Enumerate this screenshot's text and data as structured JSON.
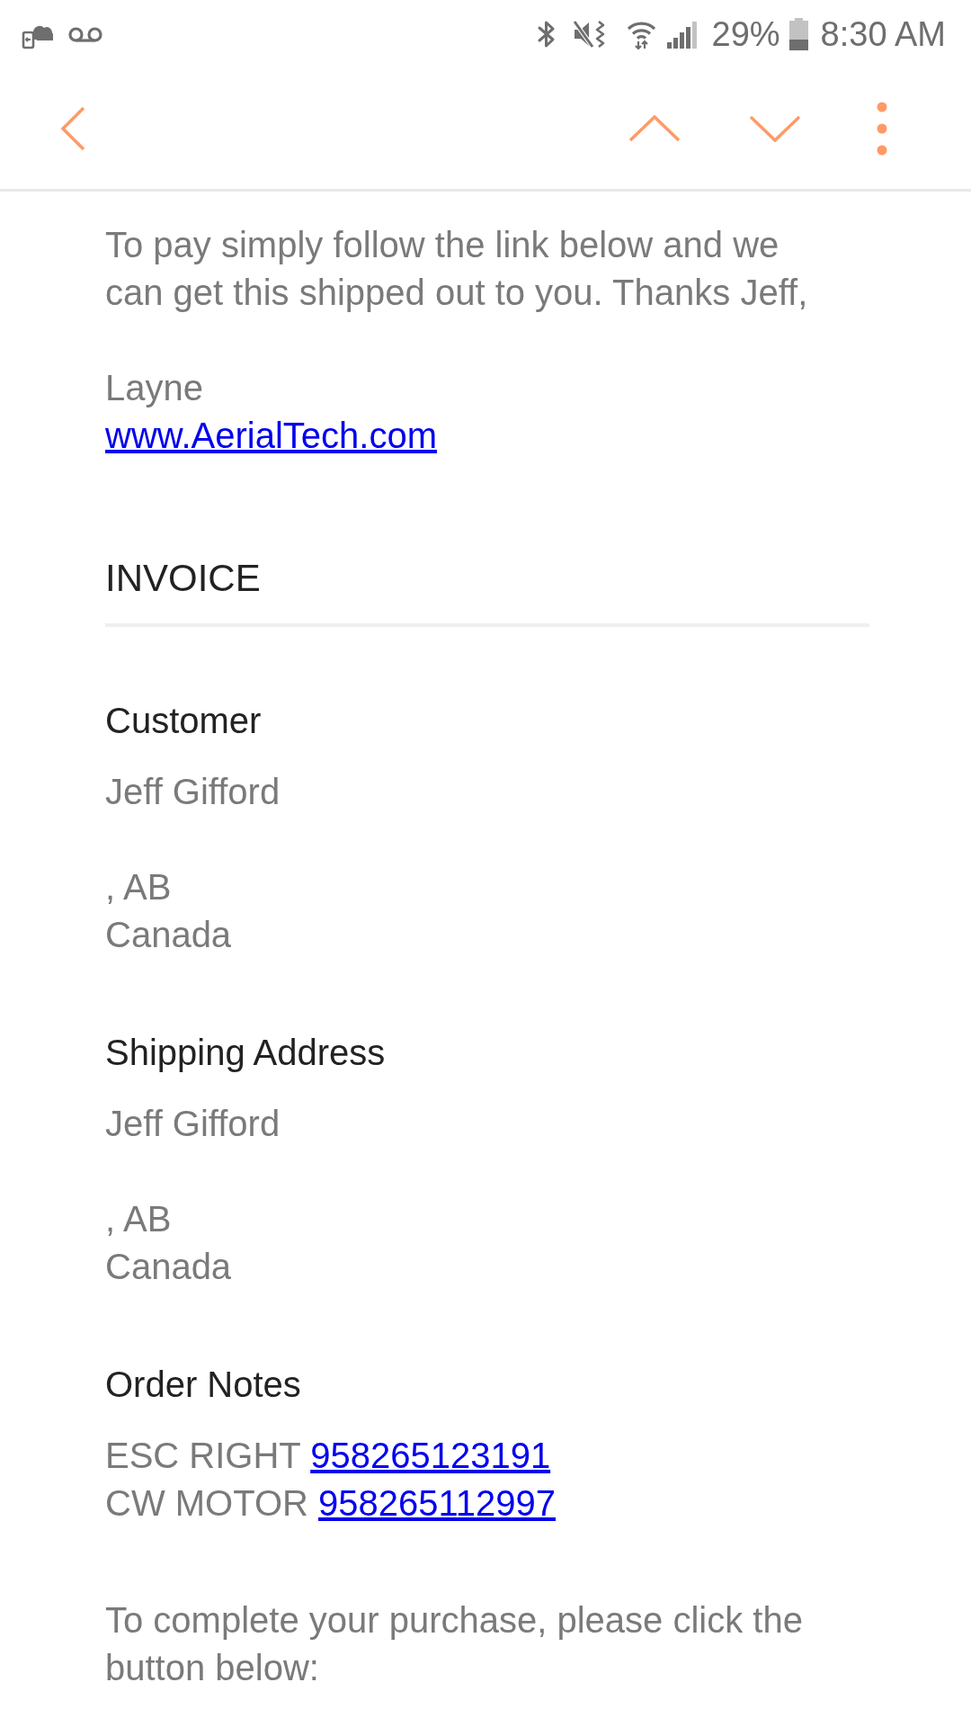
{
  "status_bar": {
    "battery_percent": "29%",
    "time": "8:30 AM"
  },
  "message": {
    "intro": "To pay simply follow the link below and we can get this shipped out to you. Thanks Jeff,",
    "sender_name": "Layne",
    "website_link": "www.AerialTech.com",
    "invoice": {
      "title": "INVOICE",
      "customer": {
        "heading": "Customer",
        "name": "Jeff Gifford",
        "address_lines": [
          ", AB",
          "Canada"
        ]
      },
      "shipping_address": {
        "heading": "Shipping Address",
        "name": "Jeff Gifford",
        "address_lines": [
          ", AB",
          "Canada"
        ]
      },
      "order_notes": {
        "heading": "Order Notes",
        "notes": [
          {
            "label": "ESC RIGHT",
            "number": "958265123191"
          },
          {
            "label": "CW MOTOR",
            "number": "958265112997"
          }
        ]
      }
    },
    "closing": "To complete your purchase, please click the button below:"
  }
}
